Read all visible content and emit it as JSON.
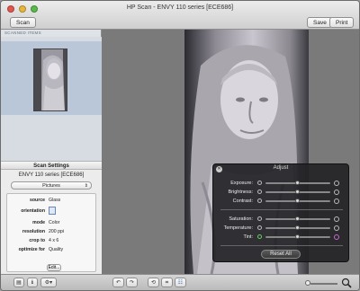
{
  "window": {
    "title": "HP Scan - ENVY 110 series [ECE686]"
  },
  "toolbar": {
    "scan_label": "Scan",
    "save_label": "Save",
    "print_label": "Print"
  },
  "sidebar": {
    "scanned_items_header": "SCANNED ITEMS"
  },
  "scan_settings": {
    "header": "Scan Settings",
    "printer_name": "ENVY 110 series [ECE686]",
    "preset_selected": "Pictures",
    "options": [
      {
        "key": "source",
        "value": "Glass"
      },
      {
        "key": "orientation",
        "value": ""
      },
      {
        "key": "mode",
        "value": "Color"
      },
      {
        "key": "resolution",
        "value": "200 ppi"
      },
      {
        "key": "crop to",
        "value": "4 x 6"
      },
      {
        "key": "optimize for",
        "value": "Quality"
      }
    ],
    "edit_label": "Edit..."
  },
  "adjust": {
    "title": "Adjust",
    "sliders": [
      {
        "label": "Exposure:",
        "level": 0.5
      },
      {
        "label": "Brightness:",
        "level": 0.5
      },
      {
        "label": "Contrast:",
        "level": 0.5
      },
      {
        "label": "Saturation:",
        "level": 0.5
      },
      {
        "label": "Temperature:",
        "level": 0.5
      },
      {
        "label": "Tint:",
        "level": 0.5
      }
    ],
    "reset_label": "Reset All"
  },
  "bottombar": {
    "icons": [
      "tab-view-icon",
      "info-icon",
      "gear-icon",
      "rotate-left-icon",
      "rotate-right-icon",
      "rotate-icon",
      "crop-icon",
      "adjust-icon",
      "zoom-icon"
    ]
  },
  "colors": {
    "accent_selection": "#b9c7d9",
    "panel_bg": "#232326"
  }
}
